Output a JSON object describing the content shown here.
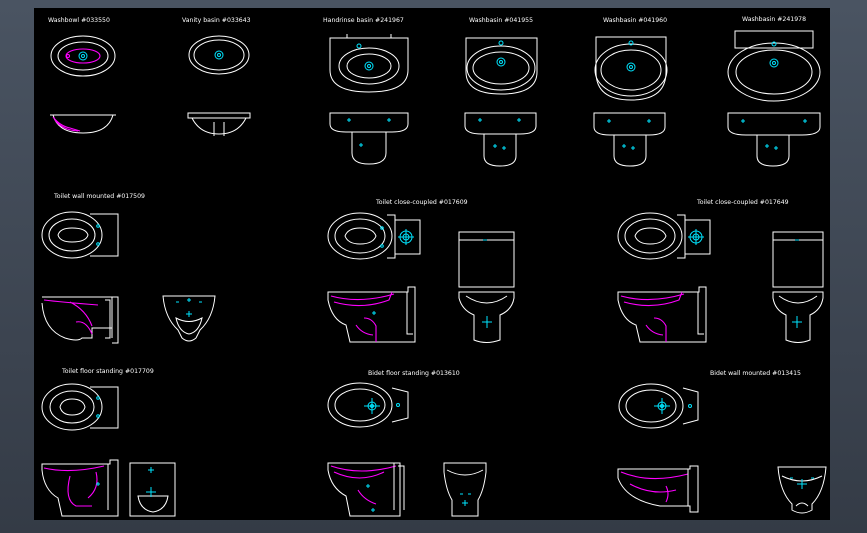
{
  "colors": {
    "background": "#000000",
    "frame": "#3d4654",
    "outline": "#ffffff",
    "hidden_edge": "#ff00ff",
    "fitting": "#00e5ff"
  },
  "drawing": {
    "labels": {
      "washbowl": "Washbowl #033550",
      "vanity_basin": "Vanity basin #033643",
      "handrinse_basin": "Handrinse basin #241967",
      "washbasin_1": "Washbasin #041955",
      "washbasin_2": "Washbasin #041960",
      "washbasin_3": "Washbasin #241978",
      "toilet_wall_mounted": "Toilet wall mounted #017509",
      "toilet_close_coupled_1": "Toilet close-coupled #017609",
      "toilet_close_coupled_2": "Toilet close-coupled #017649",
      "toilet_floor_standing": "Toilet floor standing #017709",
      "bidet_floor_standing": "Bidet floor standing #013610",
      "bidet_wall_mounted": "Bidet wall mounted #013415"
    }
  }
}
